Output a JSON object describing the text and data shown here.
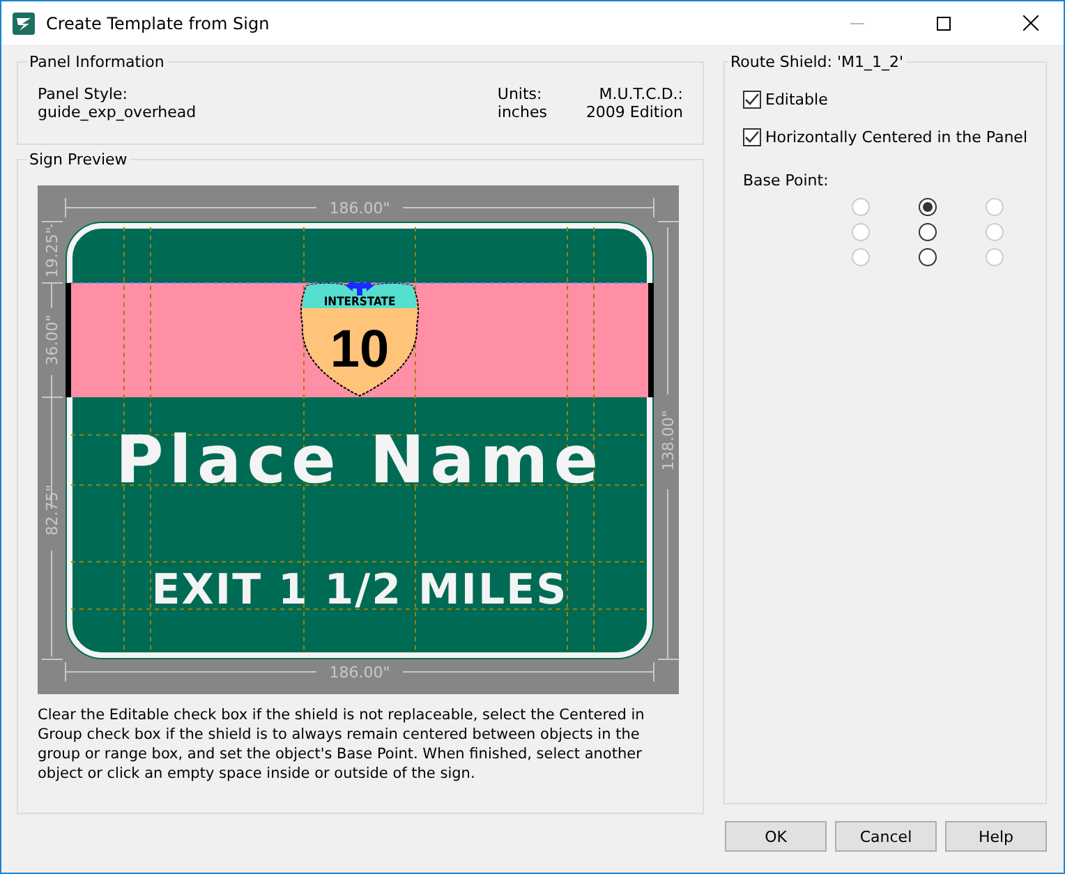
{
  "window": {
    "title": "Create Template from Sign"
  },
  "panel_information": {
    "title": "Panel Information",
    "fields": [
      {
        "label": "Panel Style:",
        "value": "guide_exp_overhead"
      },
      {
        "label": "Units:",
        "value": "inches"
      },
      {
        "label": "M.U.T.C.D.:",
        "value": "2009 Edition"
      }
    ]
  },
  "sign_preview": {
    "title": "Sign Preview",
    "dimensions": {
      "top_width": "186.00\"",
      "bottom_width": "186.00\"",
      "upper_height": "19.25\"",
      "band_height": "36.00\"",
      "lower_height": "82.75\"",
      "total_height": "138.00\""
    },
    "sign": {
      "shield_header": "INTERSTATE",
      "shield_number": "10",
      "line_1": "Place Name",
      "line_2": "EXIT 1 1/2 MILES"
    },
    "description": "Clear the Editable check box if the shield is not replaceable, select the Centered in Group check box if the shield is to always remain centered between objects in the group or range box, and set the object's Base Point. When finished, select another object or click an empty space inside or outside of the sign."
  },
  "route_shield": {
    "title": "Route Shield: 'M1_1_2'",
    "checkboxes": [
      {
        "label": "Editable",
        "checked": true
      },
      {
        "label": "Horizontally Centered in the Panel",
        "checked": true
      }
    ],
    "base_point_label": "Base Point:",
    "base_points": [
      {
        "selected": false,
        "disabled": true
      },
      {
        "selected": true,
        "disabled": false
      },
      {
        "selected": false,
        "disabled": true
      },
      {
        "selected": false,
        "disabled": true
      },
      {
        "selected": false,
        "disabled": false
      },
      {
        "selected": false,
        "disabled": true
      },
      {
        "selected": false,
        "disabled": true
      },
      {
        "selected": false,
        "disabled": false
      },
      {
        "selected": false,
        "disabled": true
      }
    ]
  },
  "buttons": [
    "OK",
    "Cancel",
    "Help"
  ]
}
